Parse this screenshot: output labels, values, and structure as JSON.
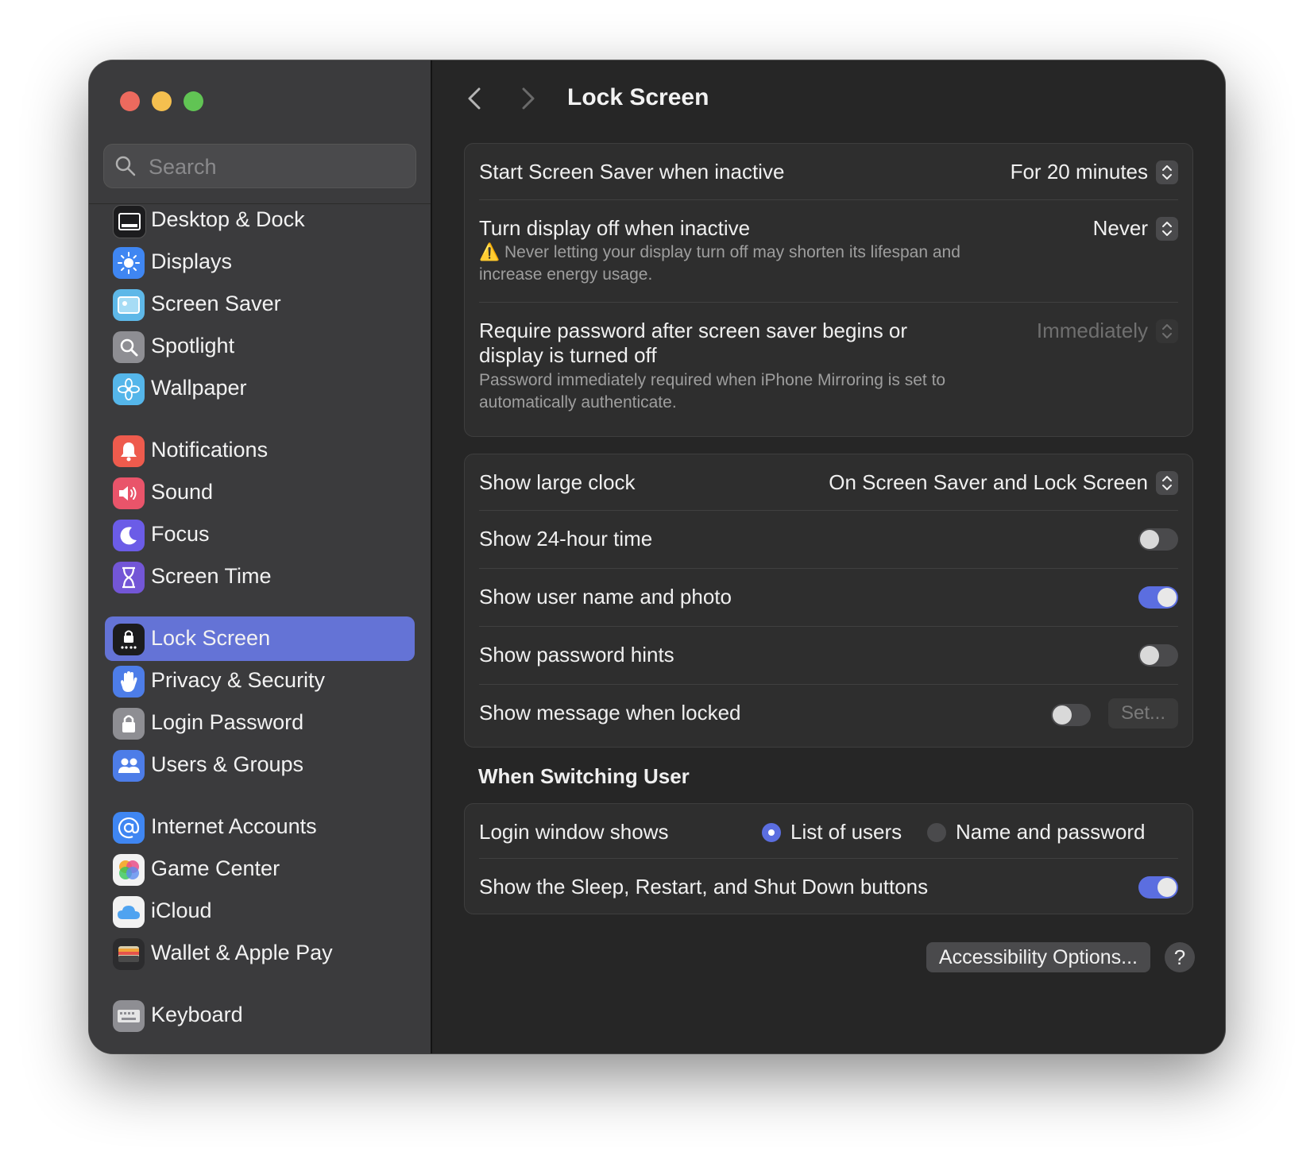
{
  "window": {
    "title": "Lock Screen"
  },
  "search": {
    "placeholder": "Search"
  },
  "sidebar": {
    "items": [
      {
        "label": "Desktop & Dock",
        "icon": "dock-icon",
        "color": "#1c1c1e"
      },
      {
        "label": "Displays",
        "icon": "sun-icon",
        "color": "#3f86f2"
      },
      {
        "label": "Screen Saver",
        "icon": "screensaver-icon",
        "color": "#5eb8e8"
      },
      {
        "label": "Spotlight",
        "icon": "magnifier-icon",
        "color": "#8e8e93"
      },
      {
        "label": "Wallpaper",
        "icon": "flower-icon",
        "color": "#55b6ea"
      },
      {
        "label": "Notifications",
        "icon": "bell-icon",
        "color": "#ee5b4d"
      },
      {
        "label": "Sound",
        "icon": "speaker-icon",
        "color": "#e9546a"
      },
      {
        "label": "Focus",
        "icon": "moon-icon",
        "color": "#6b5ce7"
      },
      {
        "label": "Screen Time",
        "icon": "hourglass-icon",
        "color": "#7356d6"
      },
      {
        "label": "Lock Screen",
        "icon": "lock-screen-icon",
        "color": "#1c1c1e"
      },
      {
        "label": "Privacy & Security",
        "icon": "hand-icon",
        "color": "#4d7de8"
      },
      {
        "label": "Login Password",
        "icon": "padlock-icon",
        "color": "#8e8e93"
      },
      {
        "label": "Users & Groups",
        "icon": "users-icon",
        "color": "#4d7de8"
      },
      {
        "label": "Internet Accounts",
        "icon": "at-icon",
        "color": "#3f86f2"
      },
      {
        "label": "Game Center",
        "icon": "game-center-icon",
        "color": "#f2f2f2"
      },
      {
        "label": "iCloud",
        "icon": "cloud-icon",
        "color": "#f2f2f2"
      },
      {
        "label": "Wallet & Apple Pay",
        "icon": "wallet-icon",
        "color": "#2c2c2e"
      },
      {
        "label": "Keyboard",
        "icon": "keyboard-icon",
        "color": "#8e8e93"
      }
    ]
  },
  "main": {
    "title": "Lock Screen",
    "group1": {
      "screensaver": {
        "label": "Start Screen Saver when inactive",
        "value": "For 20 minutes"
      },
      "display_off": {
        "label": "Turn display off when inactive",
        "value": "Never",
        "warning_icon": "⚠️",
        "warning": "Never letting your display turn off may shorten its lifespan and increase energy usage."
      },
      "password": {
        "label": "Require password after screen saver begins or display is turned off",
        "value": "Immediately",
        "note": "Password immediately required when iPhone Mirroring is set to automatically authenticate."
      }
    },
    "group2": {
      "large_clock": {
        "label": "Show large clock",
        "value": "On Screen Saver and Lock Screen"
      },
      "hour24": {
        "label": "Show 24-hour time",
        "on": false
      },
      "user_photo": {
        "label": "Show user name and photo",
        "on": true
      },
      "hints": {
        "label": "Show password hints",
        "on": false
      },
      "message": {
        "label": "Show message when locked",
        "on": false,
        "button": "Set..."
      }
    },
    "switching": {
      "title": "When Switching User",
      "login_window": {
        "label": "Login window shows",
        "option1": "List of users",
        "option2": "Name and password",
        "selected": "List of users"
      },
      "sleep_buttons": {
        "label": "Show the Sleep, Restart, and Shut Down buttons",
        "on": true
      }
    },
    "footer": {
      "accessibility_button": "Accessibility Options...",
      "help_button": "?"
    }
  },
  "colors": {
    "accent": "#5b6ee0",
    "sidebar_selected": "#6473d6",
    "window_bg": "#262626",
    "sidebar_bg": "#3b3b3d"
  }
}
